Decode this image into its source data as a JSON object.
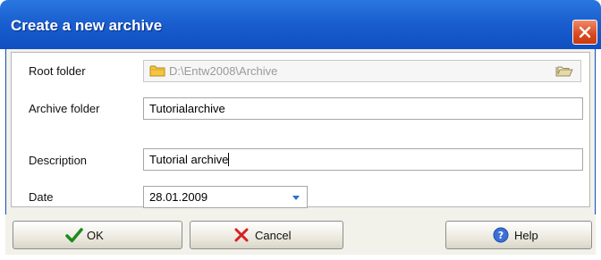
{
  "dialog": {
    "title": "Create a new archive"
  },
  "form": {
    "root_folder": {
      "label": "Root folder",
      "value": "D:\\Entw2008\\Archive"
    },
    "archive_folder": {
      "label": "Archive folder",
      "value": "Tutorialarchive"
    },
    "description": {
      "label": "Description",
      "value": "Tutorial archive"
    },
    "date": {
      "label": "Date",
      "value": "28.01.2009"
    }
  },
  "buttons": {
    "ok": "OK",
    "cancel": "Cancel",
    "help": "Help"
  },
  "colors": {
    "titlebar": "#1a5fd0",
    "close": "#d9481d",
    "ok_check": "#1f8a1f",
    "cancel_x": "#d82020",
    "help_icon": "#3d6fd6"
  }
}
